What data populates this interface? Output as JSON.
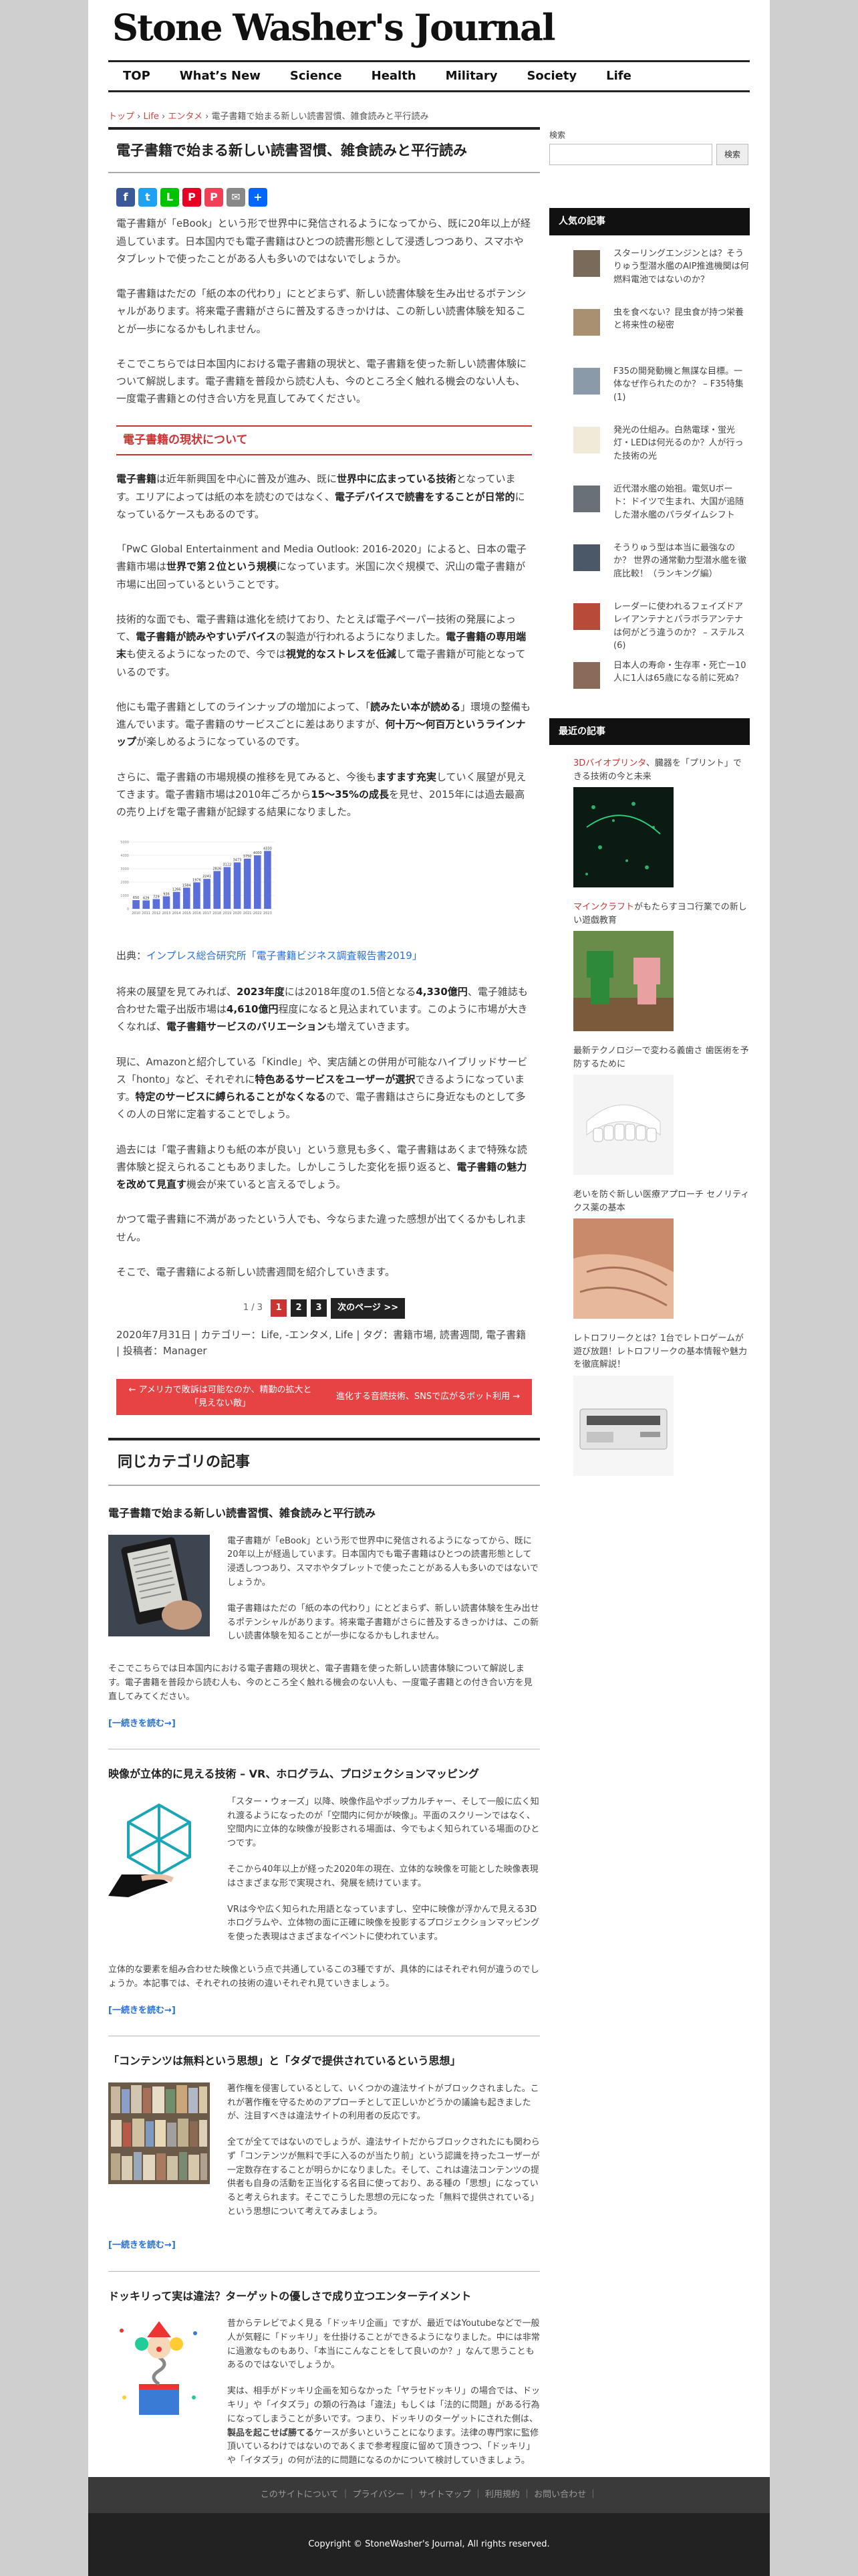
{
  "site": {
    "title": "Stone Washer's Journal"
  },
  "nav": [
    "TOP",
    "What’s New",
    "Science",
    "Health",
    "Military",
    "Society",
    "Life"
  ],
  "breadcrumb": {
    "home": "トップ",
    "l1": "Life",
    "l2": "エンタメ",
    "current": "電子書籍で始まる新しい読書習慣、雑食読みと平行読み"
  },
  "article": {
    "title": "電子書籍で始まる新しい読書習慣、雑食読みと平行読み",
    "share": [
      "f",
      "t",
      "L",
      "P",
      "P",
      "✉",
      "+"
    ],
    "p1": "電子書籍が「eBook」という形で世界中に発信されるようになってから、既に20年以上が経過しています。日本国内でも電子書籍はひとつの読書形態として浸透しつつあり、スマホやタブレットで使ったことがある人も多いのではないでしょうか。",
    "p2": "電子書籍はただの「紙の本の代わり」にとどまらず、新しい読書体験を生み出せるポテンシャルがあります。将来電子書籍がさらに普及するきっかけは、この新しい読書体験を知ることが一歩になるかもしれません。",
    "p3": "そこでこちらでは日本国内における電子書籍の現状と、電子書籍を使った新しい読書体験について解説します。電子書籍を普段から読む人も、今のところ全く触れる機会のない人も、一度電子書籍との付き合い方を見直してみてください。",
    "h2": "電子書籍の現状について",
    "p4a": "電子書籍",
    "p4b": "は近年新興国を中心に普及が進み、既に",
    "p4c": "世界中に広まっている技術",
    "p4d": "となっています。エリアによっては紙の本を読むのではなく、",
    "p4e": "電子デバイスで読書をすることが日常的",
    "p4f": "になっているケースもあるのです。",
    "p5a": "「PwC Global Entertainment and Media Outlook: 2016-2020」によると、日本の電子書籍市場は",
    "p5b": "世界で第２位という規模",
    "p5c": "になっています。米国に次ぐ規模で、沢山の電子書籍が市場に出回っているということです。",
    "p6a": "技術的な面でも、電子書籍は進化を続けており、たとえば電子ペーパー技術の発展によって、",
    "p6b": "電子書籍が読みやすいデバイス",
    "p6c": "の製造が行われるようになりました。",
    "p6d": "電子書籍の専用端末",
    "p6e": "も使えるようになったので、今では",
    "p6f": "視覚的なストレスを低減",
    "p6g": "して電子書籍が可能となっているのです。",
    "p7a": "他にも電子書籍としてのラインナップの増加によって、「",
    "p7b": "読みたい本が読める",
    "p7c": "」環境の整備も進んでいます。電子書籍のサービスごとに差はありますが、",
    "p7d": "何十万〜何百万というラインナップ",
    "p7e": "が楽しめるようになっているのです。",
    "p8a": "さらに、電子書籍の市場規模の推移を見てみると、今後も",
    "p8b": "ますます充実",
    "p8c": "していく展望が見えてきます。電子書籍市場は2010年ごろから",
    "p8d": "15〜35%の成長",
    "p8e": "を見せ、2015年には過去最高の売り上げを電子書籍が記録する結果になりました。",
    "source_label": "出典：",
    "source_link": "インプレス総合研究所「電子書籍ビジネス調査報告書2019」",
    "p9a": "将来の展望を見てみれば、",
    "p9b": "2023年度",
    "p9c": "には2018年度の1.5倍となる",
    "p9d": "4,330億円",
    "p9e": "、電子雑誌も合わせた電子出版市場は",
    "p9f": "4,610億円",
    "p9g": "程度になると見込まれています。このように市場が大きくなれば、",
    "p9h": "電子書籍サービスのバリエーション",
    "p9i": "も増えていきます。",
    "p10a": "現に、Amazonと紹介している「Kindle」や、実店舗との併用が可能なハイブリッドサービス「honto」など、それぞれに",
    "p10b": "特色あるサービスをユーザーが選択",
    "p10c": "できるようになっています。",
    "p10d": "特定のサービスに縛られることがなくなる",
    "p10e": "ので、電子書籍はさらに身近なものとして多くの人の日常に定着することでしょう。",
    "p11a": "過去には「電子書籍よりも紙の本が良い」という意見も多く、電子書籍はあくまで特殊な読書体験と捉えられることもありました。しかしこうした変化を振り返ると、",
    "p11b": "電子書籍の魅力を改めて見直す",
    "p11c": "機会が来ていると言えるでしょう。",
    "p12": "かつて電子書籍に不満があったという人でも、今ならまた違った感想が出てくるかもしれません。",
    "p13": "そこで、電子書籍による新しい読書週間を紹介していきます。"
  },
  "pager": {
    "info": "1 / 3",
    "pages": [
      "1",
      "2",
      "3"
    ],
    "next": "次のページ >>"
  },
  "meta": {
    "date": "2020年7月31日",
    "categories_label": "カテゴリー：Life, -エンタメ, Life",
    "tags_label": "タグ：書籍市場, 読書週間, 電子書籍",
    "author": "投稿者：Manager",
    "sep": "|"
  },
  "postnav": {
    "prev": "← アメリカで敗訴は可能なのか、精勤の拡大と「見えない敵」",
    "next": "進化する音読技術、SNSで広がるボット利用 →"
  },
  "related": {
    "heading": "同じカテゴリの記事",
    "more": "[一続きを読む→]",
    "items": [
      {
        "title": "電子書籍で始まる新しい読書習慣、雑食読みと平行読み",
        "t1": "電子書籍が「eBook」という形で世界中に発信されるようになってから、既に20年以上が経過しています。日本国内でも電子書籍はひとつの読書形態として浸透しつつあり、スマホやタブレットで使ったことがある人も多いのではないでしょうか。",
        "t2": "電子書籍はただの「紙の本の代わり」にとどまらず、新しい読書体験を生み出せるポテンシャルがあります。将来電子書籍がさらに普及するきっかけは、この新しい読書体験を知ることが一歩になるかもしれません。",
        "full": "そこでこちらでは日本国内における電子書籍の現状と、電子書籍を使った新しい読書体験について解説します。電子書籍を普段から読む人も、今のところ全く触れる機会のない人も、一度電子書籍との付き合い方を見直してみてください。"
      },
      {
        "title": "映像が立体的に見える技術 – VR、ホログラム、プロジェクションマッピング",
        "t1": "「スター・ウォーズ」以降、映像作品やポップカルチャー、そして一般に広く知れ渡るようになったのが「空間内に何かが映像」。平面のスクリーンではなく、空間内に立体的な映像が投影される場面は、今でもよく知られている場面のひとつです。",
        "t2": "そこから40年以上が経った2020年の現在、立体的な映像を可能とした映像表現はさまざまな形で実現され、発展を続けています。",
        "t3": "VRは今や広く知られた用語となっていますし、空中に映像が浮かんで見える3Dホログラムや、立体物の面に正確に映像を投影するプロジェクションマッピングを使った表現はさまざまなイベントに使われています。",
        "full": "立体的な要素を組み合わせた映像という点で共通しているこの3種ですが、具体的にはそれぞれ何が違うのでしょうか。本記事では、それぞれの技術の違いそれぞれ見ていきましょう。"
      },
      {
        "title": "「コンテンツは無料という思想」と「タダで提供されているという思想」",
        "t1": "著作権を侵害しているとして、いくつかの違法サイトがブロックされました。これが著作権を守るためのアプローチとして正しいかどうかの議論も起きましたが、注目すべきは違法サイトの利用者の反応です。",
        "t2": "全てが全てではないのでしょうが、違法サイトだからブロックされたにも関わらず「コンテンツが無料で手に入るのが当たり前」という認識を持ったユーザーが一定数存在することが明らかになりました。そして、これは違法コンテンツの提供者も自身の活動を正当化する名目に使っており、ある種の「思想」になっていると考えられます。そこでこうした思想の元になった「無料で提供されている」という思想について考えてみましょう。",
        "full": ""
      },
      {
        "title": "ドッキリって実は違法？ターゲットの優しさで成り立つエンターテイメント",
        "t1": "昔からテレビでよく見る「ドッキリ企画」ですが、最近ではYoutubeなどで一般人が気軽に「ドッキリ」を仕掛けることができるようになりました。中には非常に過激なものもあり、「本当にこんなことをして良いのか？」なんて思うこともあるのではないでしょうか。",
        "t2": "実は、相手がドッキリ企画を知らなかった「ヤラセドッキリ」の場合では、ドッキリ」や「イタズラ」の類の行為は「違法」もしくは「法的に問題」がある行為になってしまうことが多いです。つまり、ドッキリのターゲットにされた側は、",
        "t3": "製品を起こせば勝てる",
        "t4": "ケースが多いということになります。法律の専門家に監修頂いているわけではないのであくまで参考程度に留めて頂きつつ、「ドッキリ」や「イタズラ」の何が法的に問題になるのかについて検討していきましょう。",
        "full": ""
      }
    ]
  },
  "sidebar": {
    "search_label": "検索",
    "search_button": "検索",
    "popular_heading": "人気の記事",
    "popular": [
      "スターリングエンジンとは？そうりゅう型潜水艦のAIP推進機関は何燃料電池ではないのか？",
      "虫を食べない？昆虫食が持つ栄養と将来性の秘密",
      "F35の開発動機と無謀な目標。一体なぜ作られたのか？ – F35特集(1)",
      "発光の仕組み。白熱電球・蛍光灯・LEDは何光るのか？人が行った技術の光",
      "近代潜水艦の始祖。電気Uボート：ドイツで生まれ、大国が追随した潜水艦のパラダイムシフト",
      "そうりゅう型は本当に最強なのか？ 世界の通常動力型潜水艦を徹底比較！（ランキング編）",
      "レーダーに使われるフェイズドアレイアンテナとパラボラアンテナは何がどう違うのか？ – ステルス(6)",
      "日本人の寿命・生存率・死亡ー10人に1人は65歳になる前に死ぬ？"
    ],
    "recent_heading": "最近の記事",
    "recent": [
      {
        "a": "3Dバイオプリンタ",
        "b": "、臓器を「プリント」できる技術の今と未来"
      },
      {
        "a": "マインクラフト",
        "b": "がもたらすヨコ行業での新しい遊戯教育"
      },
      {
        "a": "",
        "b": "最新テクノロジーで変わる義歯さ 歯医術を予防するために"
      },
      {
        "a": "",
        "b": "老いを防ぐ新しい医療アプローチ セノリティクス薬の基本"
      },
      {
        "a": "",
        "b": "レトロフリークとは？1台でレトロゲームが遊び放題！レトロフリークの基本情報や魅力を徹底解説！"
      }
    ]
  },
  "footer": {
    "links": "このサイトについて ｜ プライバシー ｜ サイトマップ ｜ 利用規約 ｜ お問い合わせ ｜",
    "copyright": "Copyright © StoneWasher's Journal, All rights reserved."
  },
  "colors": {
    "accent": "#c33",
    "button": "#e84344",
    "header_bar": "#111",
    "chart_bar": "#5a6fd9"
  },
  "chart_data": {
    "type": "bar",
    "categories": [
      "2010",
      "2011",
      "2012",
      "2013",
      "2014",
      "2015",
      "2016",
      "2017",
      "2018",
      "2019",
      "2020",
      "2021",
      "2022",
      "2023"
    ],
    "values": [
      650,
      629,
      729,
      936,
      1266,
      1584,
      1976,
      2241,
      2826,
      3122,
      3473,
      3750,
      4000,
      4330
    ],
    "ylim": [
      0,
      5000
    ]
  }
}
